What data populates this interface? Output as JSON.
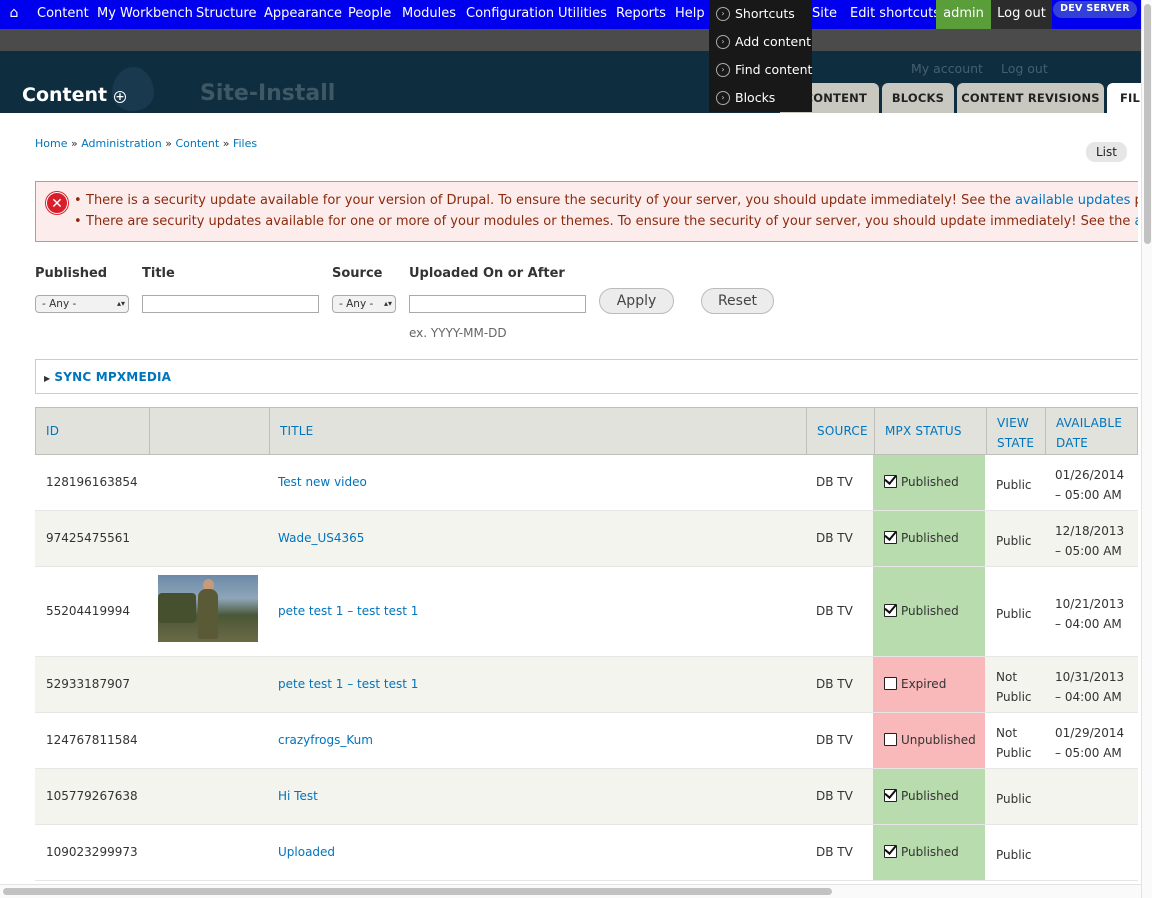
{
  "toolbar": {
    "home_icon": "home-icon",
    "items": [
      {
        "label": "Content"
      },
      {
        "label": "My Workbench"
      },
      {
        "label": "Structure"
      },
      {
        "label": "Appearance"
      },
      {
        "label": "People"
      },
      {
        "label": "Modules"
      },
      {
        "label": "Configuration"
      },
      {
        "label": "Utilities"
      },
      {
        "label": "Reports"
      },
      {
        "label": "Help"
      }
    ],
    "site_fragment": "Site",
    "edit_shortcuts": "Edit shortcuts",
    "admin": "admin",
    "logout": "Log out",
    "dev_badge": "DEV SERVER",
    "colors": {
      "bar": "#0000ee",
      "admin": "#5a9e3a",
      "dropdown": "#181818"
    }
  },
  "shortcuts_menu": {
    "items": [
      {
        "label": "Shortcuts"
      },
      {
        "label": "Add content"
      },
      {
        "label": "Find content"
      },
      {
        "label": "Blocks"
      }
    ]
  },
  "header": {
    "title": "Content",
    "site_name": "Site-Install",
    "my_account": "My account",
    "log_out": "Log out",
    "tabs": [
      {
        "label": "CONTENT",
        "active": false
      },
      {
        "label": "BLOCKS",
        "active": false
      },
      {
        "label": "CONTENT REVISIONS",
        "active": false
      },
      {
        "label": "FIL",
        "active": true
      }
    ]
  },
  "breadcrumb": {
    "items": [
      "Home",
      "Administration",
      "Content",
      "Files"
    ],
    "separator": "»"
  },
  "list_button": "List",
  "messages": {
    "items": [
      {
        "text": "There is a security update available for your version of Drupal. To ensure the security of your server, you should update immediately! See the ",
        "link": "available updates",
        "tail": " page"
      },
      {
        "text": "There are security updates available for one or more of your modules or themes. To ensure the security of your server, you should update immediately! See the ",
        "link": "avail",
        "tail": ""
      }
    ]
  },
  "filters": {
    "published_label": "Published",
    "published_value": "- Any -",
    "title_label": "Title",
    "title_value": "",
    "source_label": "Source",
    "source_value": "- Any -",
    "uploaded_label": "Uploaded On or After",
    "uploaded_value": "",
    "date_hint": "ex. YYYY-MM-DD",
    "apply": "Apply",
    "reset": "Reset"
  },
  "sync_fieldset": {
    "legend": "SYNC MPXMEDIA"
  },
  "table": {
    "headers": [
      "ID",
      "",
      "TITLE",
      "SOURCE",
      "MPX STATUS",
      "VIEW STATE",
      "AVAILABLE DATE"
    ],
    "header_lines": {
      "view_state": [
        "VIEW",
        "STATE"
      ],
      "available_date": [
        "AVAILABLE",
        "DATE"
      ]
    },
    "rows": [
      {
        "id": "128196163854",
        "title": "Test new video",
        "source": "DB TV",
        "status": "Published",
        "checked": true,
        "view": [
          "Public"
        ],
        "date": [
          "01/26/2014",
          "– 05:00 AM"
        ],
        "thumb": false
      },
      {
        "id": "97425475561",
        "title": "Wade_US4365",
        "source": "DB TV",
        "status": "Published",
        "checked": true,
        "view": [
          "Public"
        ],
        "date": [
          "12/18/2013",
          "– 05:00 AM"
        ],
        "thumb": false
      },
      {
        "id": "55204419994",
        "title": "pete test 1 – test test 1",
        "source": "DB TV",
        "status": "Published",
        "checked": true,
        "view": [
          "Public"
        ],
        "date": [
          "10/21/2013",
          "– 04:00 AM"
        ],
        "thumb": true
      },
      {
        "id": "52933187907",
        "title": "pete test 1 – test test 1",
        "source": "DB TV",
        "status": "Expired",
        "checked": false,
        "view": [
          "Not",
          "Public"
        ],
        "date": [
          "10/31/2013",
          "– 04:00 AM"
        ],
        "thumb": false
      },
      {
        "id": "124767811584",
        "title": "crazyfrogs_Kum",
        "source": "DB TV",
        "status": "Unpublished",
        "checked": false,
        "view": [
          "Not",
          "Public"
        ],
        "date": [
          "01/29/2014",
          "– 05:00 AM"
        ],
        "thumb": false
      },
      {
        "id": "105779267638",
        "title": "Hi Test",
        "source": "DB TV",
        "status": "Published",
        "checked": true,
        "view": [
          "Public"
        ],
        "date": [
          "",
          ""
        ],
        "thumb": false
      },
      {
        "id": "109023299973",
        "title": "Uploaded",
        "source": "DB TV",
        "status": "Published",
        "checked": true,
        "view": [
          "Public"
        ],
        "date": [
          "",
          ""
        ],
        "thumb": false
      }
    ],
    "status_colors": {
      "published": "#b8dcae",
      "other": "#f9b9bb"
    }
  }
}
